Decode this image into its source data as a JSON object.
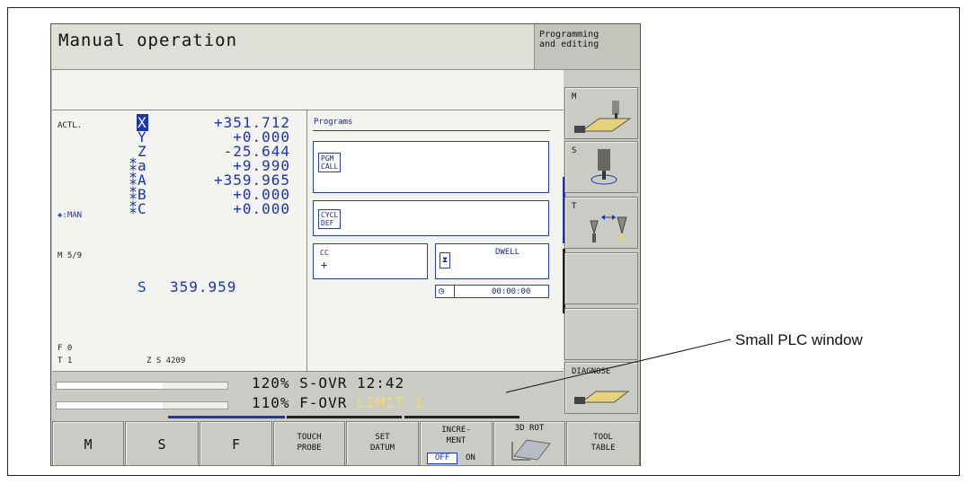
{
  "header": {
    "title": "Manual operation",
    "side_mode": "Programming\nand editing"
  },
  "position": {
    "actl_label": "ACTL.",
    "axes": [
      {
        "axis": "X",
        "value": "+351.712",
        "highlighted": true
      },
      {
        "axis": "Y",
        "value": "+0.000"
      },
      {
        "axis": "Z",
        "value": "-25.644"
      },
      {
        "axis": "⁑a",
        "value": "+9.990"
      },
      {
        "axis": "⁑A",
        "value": "+359.965"
      },
      {
        "axis": "⁑B",
        "value": "+0.000"
      },
      {
        "axis": "⁑C",
        "value": "+0.000"
      }
    ],
    "man_label": "◈:MAN",
    "m_label": "M 5/9",
    "spindle_label": "S",
    "spindle_value": "359.959",
    "feed_label": "F 0",
    "tool_label": "T 1",
    "tool_extra": "Z S 4209"
  },
  "programs": {
    "title": "Programs",
    "pgm_call": "PGM\nCALL",
    "cycl_def": "CYCL\nDEF",
    "cc": "CC",
    "dwell": "DWELL",
    "timer": "00:00:00"
  },
  "status": {
    "s_ovr": "120% S-OVR 12:42",
    "f_ovr_prefix": "110% F-OVR ",
    "f_ovr_limit": "LIMIT 1",
    "s_ovr_fill": 0.62,
    "f_ovr_fill": 0.62
  },
  "right_keys": {
    "m": "M",
    "s": "S",
    "t": "T",
    "diagnose": "DIAGNOSE"
  },
  "bottom_keys": {
    "m": "M",
    "s": "S",
    "f": "F",
    "touch_probe": "TOUCH\nPROBE",
    "set_datum": "SET\nDATUM",
    "increment": "INCRE-\nMENT",
    "inc_off": "OFF",
    "inc_on": "ON",
    "rot_3d": "3D ROT",
    "tool_table": "TOOL\nTABLE"
  },
  "callout": "Small PLC window",
  "colors": {
    "accent_blue": "#1a35b4",
    "limit_yellow": "#f0e060",
    "screen_bg": "#c9cbc4"
  }
}
